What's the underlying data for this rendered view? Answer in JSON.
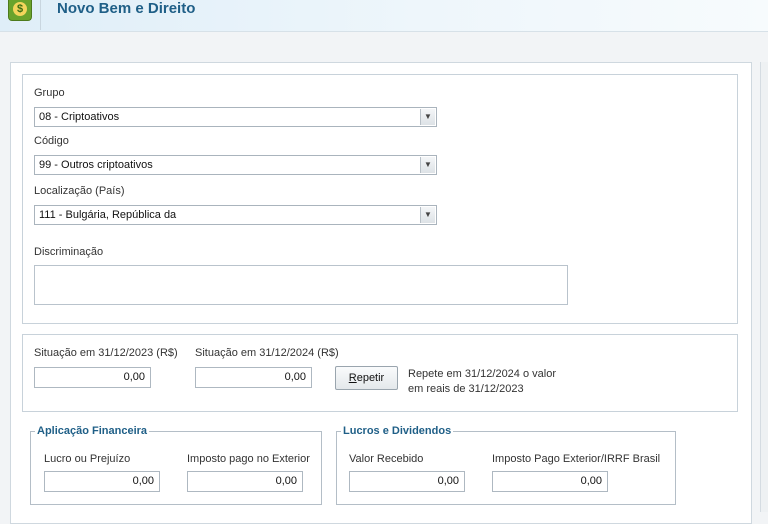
{
  "header": {
    "title": "Novo Bem e Direito",
    "app_icon_glyph": "$"
  },
  "fields": {
    "grupo": {
      "label": "Grupo",
      "value": "08 - Criptoativos"
    },
    "codigo": {
      "label": "Código",
      "value": "99 - Outros criptoativos"
    },
    "localizacao": {
      "label": "Localização (País)",
      "value": "111 - Bulgária, República da"
    },
    "discriminacao": {
      "label": "Discriminação",
      "value": ""
    }
  },
  "situacao": {
    "label_2023": "Situação em 31/12/2023 (R$)",
    "value_2023": "0,00",
    "label_2024": "Situação em 31/12/2024 (R$)",
    "value_2024": "0,00",
    "repeat_button_prefix": "",
    "repeat_button_accel": "R",
    "repeat_button_rest": "epetir",
    "repeat_hint_line1": "Repete em 31/12/2024 o valor",
    "repeat_hint_line2": "em reais de 31/12/2023"
  },
  "aplicacao": {
    "legend": "Aplicação Financeira",
    "lucro_label": "Lucro ou Prejuízo",
    "lucro_value": "0,00",
    "imposto_label": "Imposto pago no Exterior",
    "imposto_value": "0,00"
  },
  "lucros": {
    "legend": "Lucros e Dividendos",
    "valor_label": "Valor Recebido",
    "valor_value": "0,00",
    "imposto_label": "Imposto Pago Exterior/IRRF Brasil",
    "imposto_value": "0,00"
  }
}
